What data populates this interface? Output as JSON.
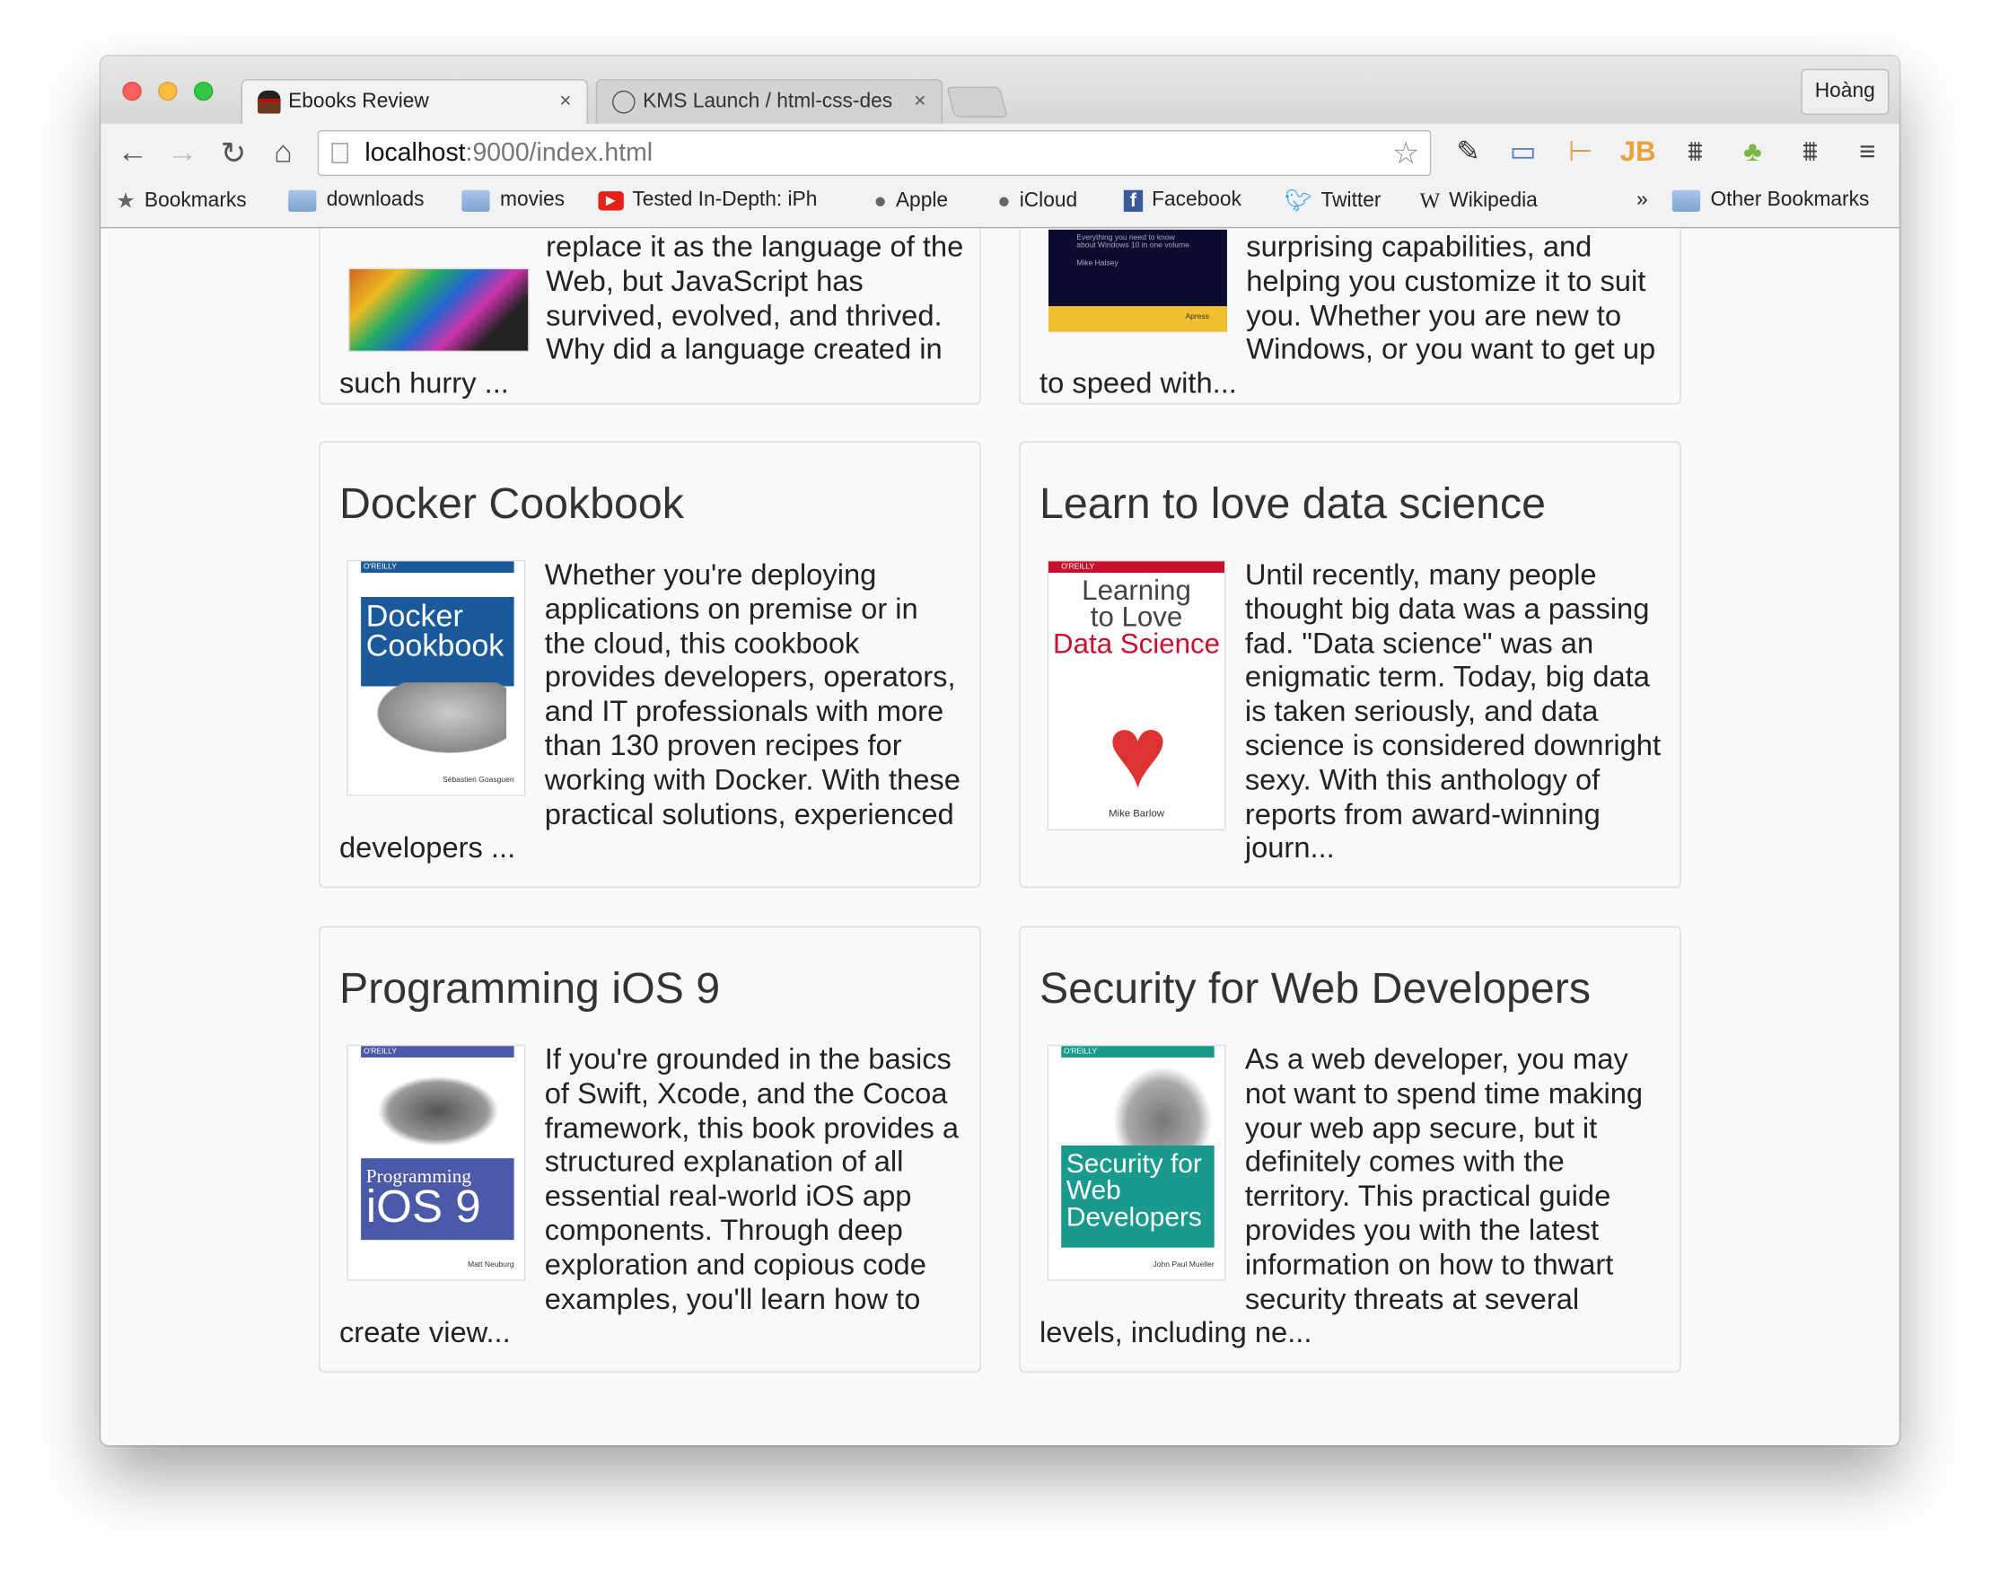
{
  "browser": {
    "tabs": [
      {
        "title": "Ebooks Review",
        "close": "×",
        "active": true
      },
      {
        "title": "KMS Launch / html-css-des",
        "close": "×",
        "active": false
      }
    ],
    "profile": "Hoàng",
    "url_host": "localhost",
    "url_path": ":9000/index.html",
    "bookmarks": [
      {
        "label": "Bookmarks",
        "icon": "star-icon"
      },
      {
        "label": "downloads",
        "icon": "folder-icon"
      },
      {
        "label": "movies",
        "icon": "folder-icon"
      },
      {
        "label": "Tested In-Depth: iPh",
        "icon": "youtube-icon"
      },
      {
        "label": "Apple",
        "icon": "apple-icon"
      },
      {
        "label": "iCloud",
        "icon": "apple-icon"
      },
      {
        "label": "Facebook",
        "icon": "facebook-icon"
      },
      {
        "label": "Twitter",
        "icon": "twitter-icon"
      },
      {
        "label": "Wikipedia",
        "icon": "wikipedia-icon"
      }
    ],
    "overflow": "»",
    "other_bookmarks": "Other Bookmarks"
  },
  "books_partial": [
    {
      "lines": [
        "replace it as the language of the",
        "Web, but JavaScript has",
        "survived, evolved, and thrived.",
        "Why did a language created in",
        "such hurry ..."
      ]
    },
    {
      "lines": [
        "surprising capabilities, and",
        "helping you customize it to suit",
        "you. Whether you are new to",
        "Windows, or you want to get up",
        "to speed with..."
      ],
      "cover_text": "Everything you need to know about Windows 10 in one volume",
      "cover_author": "Mike Halsey",
      "cover_publisher": "Apress"
    }
  ],
  "books": [
    {
      "title": "Docker Cookbook",
      "description": "Whether you're deploying applications on premise or in the cloud, this cookbook provides developers, operators, and IT professionals with more than 130 proven recipes for working with Docker. With these practical solutions, experienced developers ...",
      "cover_publisher": "O'REILLY",
      "cover_title": "Docker Cookbook",
      "cover_author": "Sébastien Goasguen",
      "cover_color": "#1a5a9a"
    },
    {
      "title": "Learn to love data science",
      "description": "Until recently, many people thought big data was a passing fad. \"Data science\" was an enigmatic term. Today, big data is taken seriously, and data science is considered downright sexy. With this anthology of reports from award-winning journ...",
      "cover_publisher": "O'REILLY",
      "cover_title_1": "Learning",
      "cover_title_2": "to Love",
      "cover_title_3": "Data Science",
      "cover_author": "Mike Barlow",
      "cover_color": "#c8102e"
    },
    {
      "title": "Programming iOS 9",
      "description": "If you're grounded in the basics of Swift, Xcode, and the Cocoa framework, this book provides a structured explanation of all essential real-world iOS app components. Through deep exploration and copious code examples, you'll learn how to create view...",
      "cover_publisher": "O'REILLY",
      "cover_title_1": "Programming",
      "cover_title_2": "iOS 9",
      "cover_author": "Matt Neuburg",
      "cover_color": "#4a5aa8"
    },
    {
      "title": "Security for Web Developers",
      "description": "As a web developer, you may not want to spend time making your web app secure, but it definitely comes with the territory. This practical guide provides you with the latest information on how to thwart security threats at several levels, including ne...",
      "cover_publisher": "O'REILLY",
      "cover_title": "Security for Web Developers",
      "cover_author": "John Paul Mueller",
      "cover_color": "#1a9a8c"
    }
  ]
}
